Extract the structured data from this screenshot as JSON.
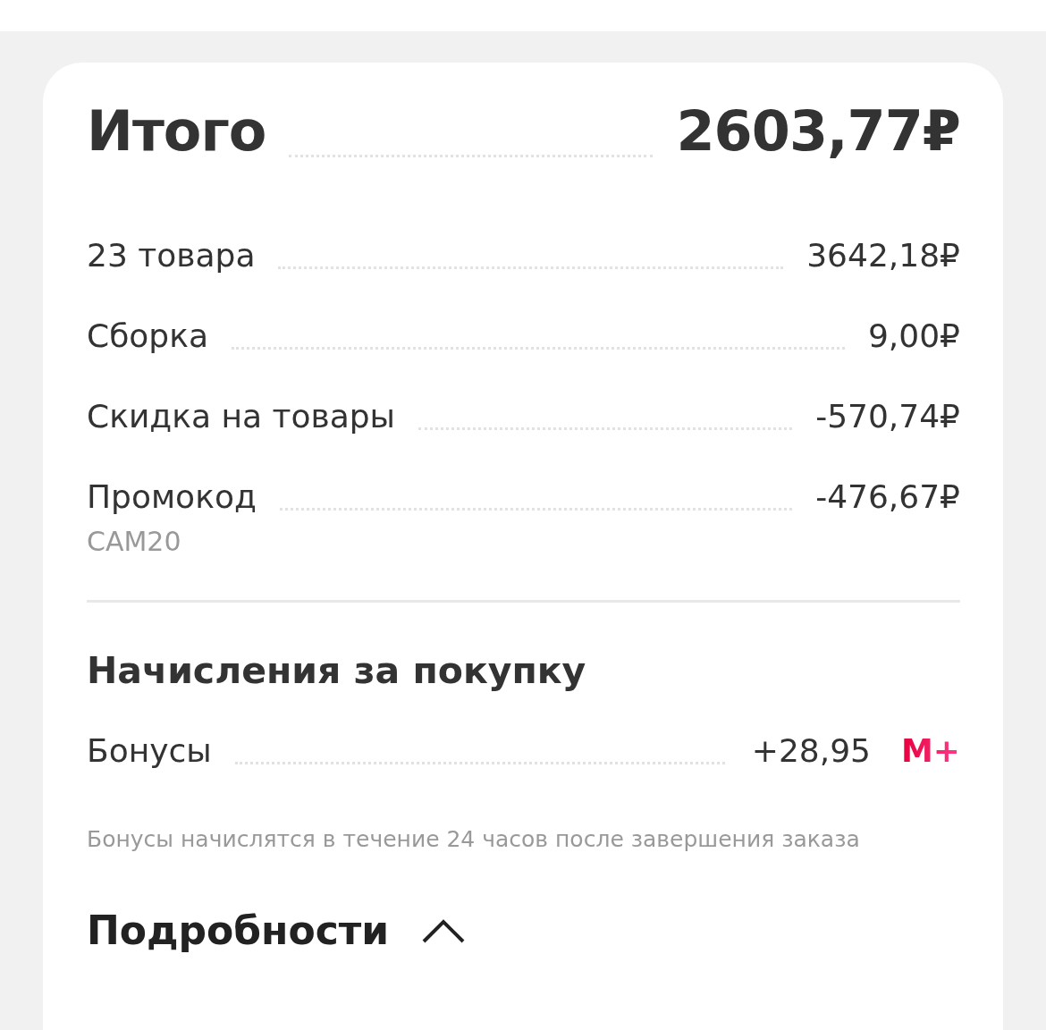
{
  "total": {
    "label": "Итого",
    "value": "2603,77₽"
  },
  "rows": [
    {
      "label": "23 товара",
      "value": "3642,18₽"
    },
    {
      "label": "Сборка",
      "value": "9,00₽"
    },
    {
      "label": "Скидка на товары",
      "value": "-570,74₽"
    },
    {
      "label": "Промокод",
      "value": "-476,67₽",
      "note": "CAM20"
    }
  ],
  "accruals": {
    "title": "Начисления за покупку",
    "label": "Бонусы",
    "value": "+28,95",
    "logo": "M+",
    "note": "Бонусы начислятся в течение 24 часов после завершения заказа"
  },
  "details": {
    "label": "Подробности",
    "expanded": true
  }
}
